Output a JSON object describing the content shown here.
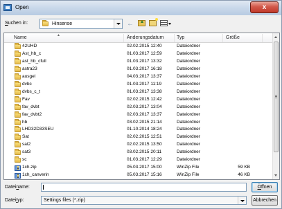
{
  "window": {
    "title": "Open",
    "close_label": "x"
  },
  "lookin": {
    "label_prefix": "S",
    "label_rest": "uchen in:",
    "value": "Hinsense"
  },
  "list": {
    "columns": [
      "Name",
      "Änderungsdatum",
      "Typ",
      "Größe"
    ],
    "items": [
      {
        "name": "42UHD",
        "date": "02.02.2015 12:40",
        "type": "Dateiordner",
        "size": "",
        "icon": "folder-icon"
      },
      {
        "name": "Ast_hb_c",
        "date": "01.03.2017 12:59",
        "type": "Dateiordner",
        "size": "",
        "icon": "folder-icon"
      },
      {
        "name": "ast_hb_cfull",
        "date": "01.03.2017 13:32",
        "type": "Dateiordner",
        "size": "",
        "icon": "folder-icon"
      },
      {
        "name": "astra23",
        "date": "01.03.2017 16:18",
        "type": "Dateiordner",
        "size": "",
        "icon": "folder-icon"
      },
      {
        "name": "ausgel",
        "date": "04.03.2017 13:37",
        "type": "Dateiordner",
        "size": "",
        "icon": "folder-icon"
      },
      {
        "name": "dvbc",
        "date": "01.03.2017 11:19",
        "type": "Dateiordner",
        "size": "",
        "icon": "folder-icon"
      },
      {
        "name": "dvbs_c_t",
        "date": "01.03.2017 13:38",
        "type": "Dateiordner",
        "size": "",
        "icon": "folder-icon"
      },
      {
        "name": "Fav",
        "date": "02.02.2015 12:42",
        "type": "Dateiordner",
        "size": "",
        "icon": "folder-icon"
      },
      {
        "name": "fav_dvbt",
        "date": "02.03.2017 13:04",
        "type": "Dateiordner",
        "size": "",
        "icon": "folder-icon"
      },
      {
        "name": "fav_dvbt2",
        "date": "02.03.2017 13:37",
        "type": "Dateiordner",
        "size": "",
        "icon": "folder-icon"
      },
      {
        "name": "hb",
        "date": "03.02.2015 21:14",
        "type": "Dateiordner",
        "size": "",
        "icon": "folder-icon"
      },
      {
        "name": "LHD32D33SEU",
        "date": "01.10.2014 18:24",
        "type": "Dateiordner",
        "size": "",
        "icon": "folder-icon"
      },
      {
        "name": "Sat",
        "date": "02.02.2015 12:51",
        "type": "Dateiordner",
        "size": "",
        "icon": "folder-icon"
      },
      {
        "name": "sat2",
        "date": "02.02.2015 13:50",
        "type": "Dateiordner",
        "size": "",
        "icon": "folder-icon"
      },
      {
        "name": "sat3",
        "date": "03.02.2015 20:11",
        "type": "Dateiordner",
        "size": "",
        "icon": "folder-icon"
      },
      {
        "name": "sc",
        "date": "01.03.2017 12:29",
        "type": "Dateiordner",
        "size": "",
        "icon": "folder-icon"
      },
      {
        "name": "1ch.zip",
        "date": "05.03.2017 15:00",
        "type": "WinZip File",
        "size": "59 KB",
        "icon": "zip-icon"
      },
      {
        "name": "1ch_canverin",
        "date": "05.03.2017 15:16",
        "type": "WinZip File",
        "size": "46 KB",
        "icon": "zip-icon"
      }
    ]
  },
  "filename": {
    "label_prefix": "Datei",
    "label_underlined": "n",
    "label_rest": "ame:",
    "value": "",
    "placeholder": ""
  },
  "filetype": {
    "label_prefix": "Datei",
    "label_underlined": "t",
    "label_rest": "yp:",
    "value": "Settings files (*.zip)"
  },
  "buttons": {
    "open_underlined": "Ö",
    "open_rest": "ffnen",
    "cancel": "Abbrechen"
  }
}
